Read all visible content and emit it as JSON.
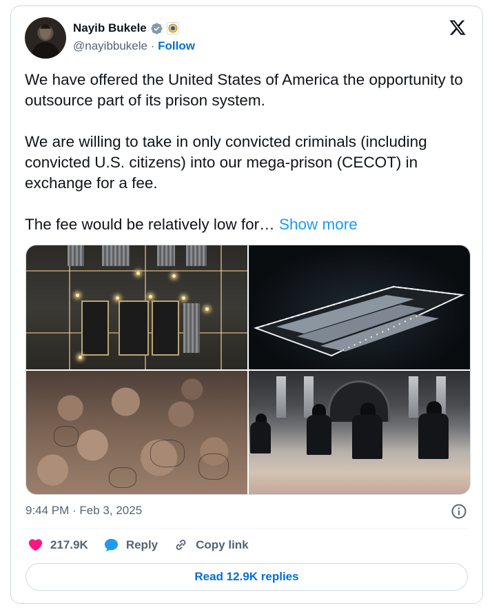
{
  "author": {
    "name": "Nayib Bukele",
    "handle": "@nayibbukele",
    "separator": "·",
    "follow_label": "Follow"
  },
  "tweet": {
    "paragraph1": "We have offered the United States of America the opportunity to outsource part of its prison system.",
    "paragraph2": "We are willing to take in only convicted criminals (including convicted U.S. citizens) into our mega-prison (CECOT) in exchange for a fee.",
    "paragraph3": "The fee would be relatively low for…",
    "show_more_label": "Show more"
  },
  "media": {
    "count": 4,
    "photos": [
      "aerial-prison-night",
      "prison-complex-angled-night",
      "inmates-seated",
      "guards-with-inmates"
    ]
  },
  "meta": {
    "timestamp": "9:44 PM · Feb 3, 2025"
  },
  "actions": {
    "likes": "217.9K",
    "reply_label": "Reply",
    "copy_link_label": "Copy link"
  },
  "replies_button": "Read 12.9K replies",
  "icons": {
    "verified": "verified-badge-icon",
    "government": "government-affiliation-icon",
    "brand": "x-logo-icon",
    "info": "info-icon",
    "like": "heart-icon",
    "reply": "speech-bubble-icon",
    "copy": "link-icon"
  },
  "colors": {
    "accent": "#1d9bf0",
    "follow": "#006fd6",
    "like": "#f91880",
    "muted": "#536471",
    "border": "#cfd9de"
  }
}
